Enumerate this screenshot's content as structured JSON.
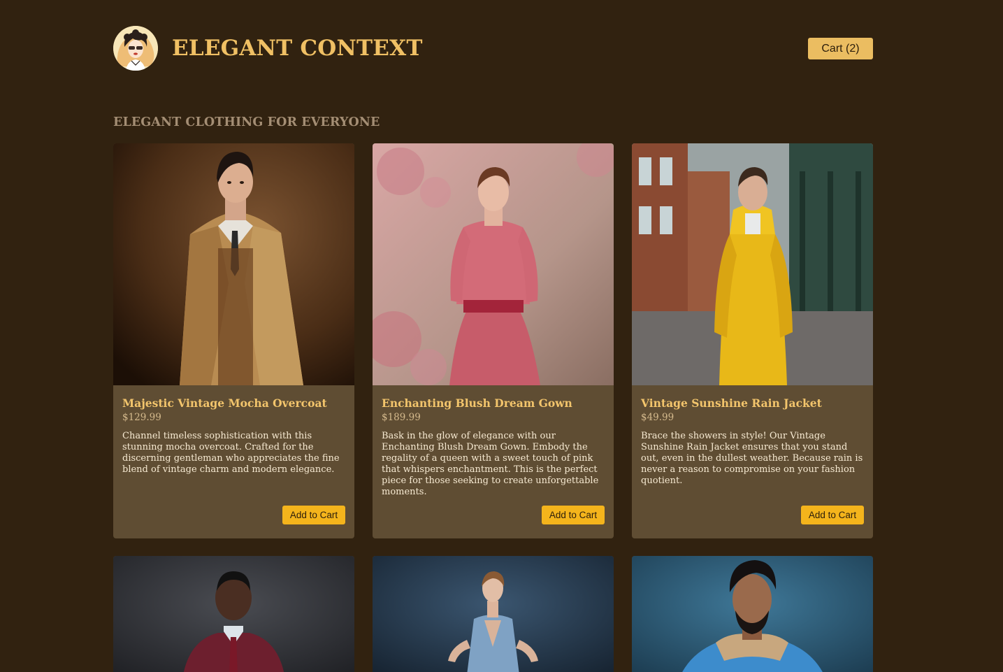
{
  "header": {
    "site_title": "ELEGANT CONTEXT",
    "cart_label": "Cart (2)",
    "logo_icon": "vintage-lady-logo-icon"
  },
  "main": {
    "section_title": "ELEGANT CLOTHING FOR EVERYONE",
    "products": [
      {
        "name": "Majestic Vintage Mocha Overcoat",
        "price": "$129.99",
        "description": "Channel timeless sophistication with this stunning mocha overcoat. Crafted for the discerning gentleman who appreciates the fine blend of vintage charm and modern elegance.",
        "button_label": "Add to Cart"
      },
      {
        "name": "Enchanting Blush Dream Gown",
        "price": "$189.99",
        "description": "Bask in the glow of elegance with our Enchanting Blush Dream Gown. Embody the regality of a queen with a sweet touch of pink that whispers enchantment. This is the perfect piece for those seeking to create unforgettable moments.",
        "button_label": "Add to Cart"
      },
      {
        "name": "Vintage Sunshine Rain Jacket",
        "price": "$49.99",
        "description": "Brace the showers in style! Our Vintage Sunshine Rain Jacket ensures that you stand out, even in the dullest weather. Because rain is never a reason to compromise on your fashion quotient.",
        "button_label": "Add to Cart"
      }
    ]
  },
  "colors": {
    "background": "#312210",
    "card": "#5f4d33",
    "accent": "#f4b41c",
    "title": "#f0c064"
  }
}
